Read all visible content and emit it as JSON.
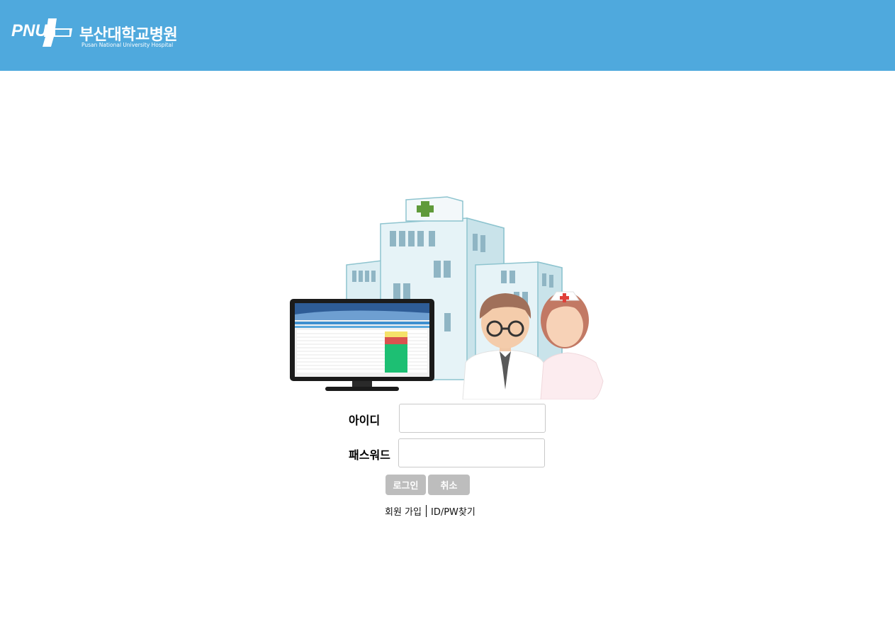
{
  "header": {
    "background_color": "#4fa9dd",
    "logo": {
      "mark_text": "PNU",
      "name_ko": "부산대학교병원",
      "name_en": "Pusan National University Hospital"
    }
  },
  "login_form": {
    "id_label": "아이디",
    "id_value": "",
    "password_label": "패스워드",
    "password_value": "",
    "login_button": "로그인",
    "cancel_button": "취소",
    "signup_link": "회원 가입",
    "find_link": "ID/PW찾기"
  }
}
